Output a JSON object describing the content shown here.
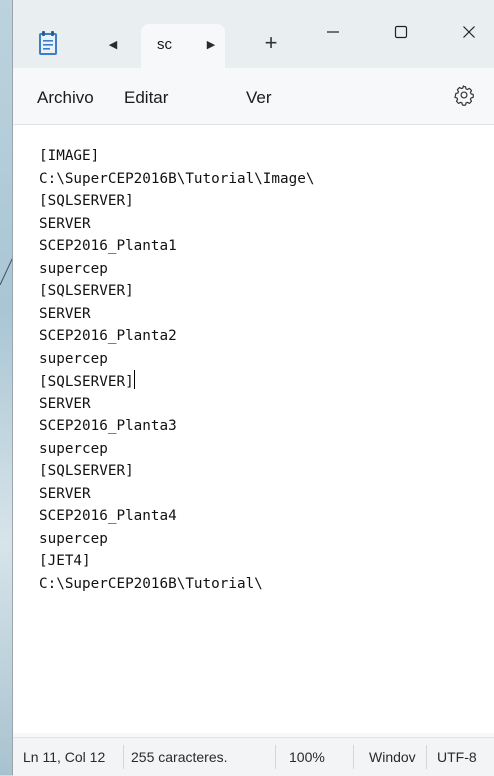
{
  "tabs": [
    {
      "label": "sc",
      "active": true
    }
  ],
  "window_controls": {
    "minimize": "—",
    "maximize": "☐",
    "close": "✕"
  },
  "menu": {
    "archivo": "Archivo",
    "editar": "Editar",
    "ver": "Ver"
  },
  "icons": {
    "app": "notepad-icon",
    "scroll_left": "tab-scroll-left-icon",
    "scroll_right": "tab-scroll-right-icon",
    "new_tab": "plus-icon",
    "settings": "gear-icon",
    "caret_indicator": "▶"
  },
  "editor": {
    "lines": [
      "[IMAGE]",
      "C:\\SuperCEP2016B\\Tutorial\\Image\\",
      "[SQLSERVER]",
      "SERVER",
      "SCEP2016_Planta1",
      "supercep",
      "[SQLSERVER]",
      "SERVER",
      "SCEP2016_Planta2",
      "supercep",
      "[SQLSERVER]",
      "SERVER",
      "SCEP2016_Planta3",
      "supercep",
      "[SQLSERVER]",
      "SERVER",
      "SCEP2016_Planta4",
      "supercep",
      "[JET4]",
      "C:\\SuperCEP2016B\\Tutorial\\"
    ]
  },
  "status": {
    "position": "Ln 11, Col 12",
    "characters": "255 caracteres.",
    "zoom": "100%",
    "line_ending": "Windov",
    "encoding": "UTF-8"
  },
  "colors": {
    "titlebar": "#e9eef1",
    "window": "#f6f8f9",
    "editor": "#ffffff"
  }
}
